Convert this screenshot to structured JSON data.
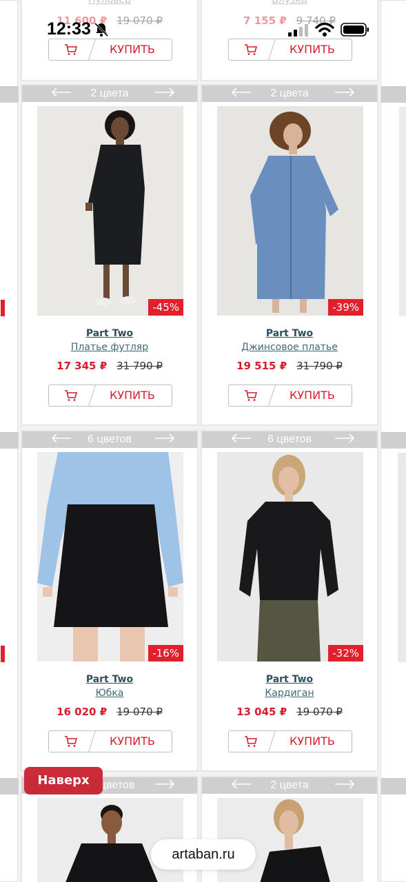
{
  "status_bar": {
    "time": "12:33"
  },
  "top_row": [
    {
      "name": "Пуловер",
      "price_new": "11 600 ₽",
      "price_old": "19 070 ₽",
      "buy_label": "КУПИТЬ"
    },
    {
      "name": "Блузка",
      "price_new": "7 155 ₽",
      "price_old": "9 740 ₽",
      "buy_label": "КУПИТЬ"
    }
  ],
  "products": [
    {
      "colors": "2 цвета",
      "discount": "-45%",
      "brand": "Part Two",
      "name": "Платье футляр",
      "price_new": "17 345 ₽",
      "price_old": "31 790 ₽",
      "buy_label": "КУПИТЬ"
    },
    {
      "colors": "2 цвета",
      "discount": "-39%",
      "brand": "Part Two",
      "name": "Джинсовое платье",
      "price_new": "19 515 ₽",
      "price_old": "31 790 ₽",
      "buy_label": "КУПИТЬ"
    },
    {
      "colors": "6 цветов",
      "discount": "-16%",
      "brand": "Part Two",
      "name": "Юбка",
      "price_new": "16 020 ₽",
      "price_old": "19 070 ₽",
      "buy_label": "КУПИТЬ"
    },
    {
      "colors": "6 цветов",
      "discount": "-32%",
      "brand": "Part Two",
      "name": "Кардиган",
      "price_new": "13 045 ₽",
      "price_old": "19 070 ₽",
      "buy_label": "КУПИТЬ"
    },
    {
      "colors": "12 цветов"
    },
    {
      "colors": "2 цвета"
    }
  ],
  "scroll_top_label": "Наверх",
  "browser": {
    "domain": "artaban.ru"
  },
  "colors": {
    "accent": "#d81c2b",
    "header_bar": "#cfcfcf",
    "brand_text": "#2e4f5b"
  }
}
